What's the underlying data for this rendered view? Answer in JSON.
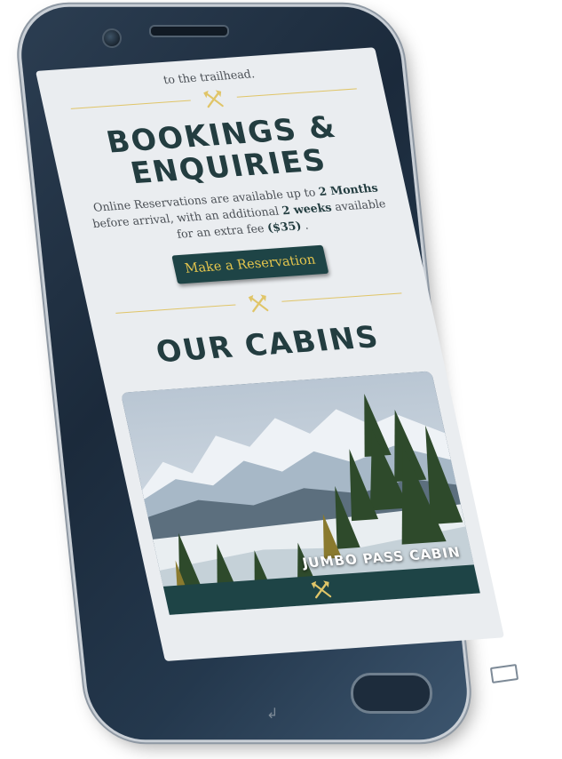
{
  "top": {
    "trailhead_text": "to the trailhead."
  },
  "bookings": {
    "heading": "Bookings & Enquiries",
    "text_part1": "Online Reservations are available up to ",
    "text_bold1": "2 Months",
    "text_part2": " before arrival, with an additional ",
    "text_bold2": "2 weeks",
    "text_part3": " available for an extra fee ",
    "text_bold3": "($35)",
    "text_part4": " .",
    "button_label": "Make a Reservation"
  },
  "cabins": {
    "heading": "Our Cabins",
    "card_title": "Jumbo Pass Cabin"
  },
  "colors": {
    "accent_gold": "#e0c568",
    "dark_teal": "#1e4446",
    "screen_bg": "#eaedf0"
  },
  "icons": {
    "divider": "crossed-axes-icon",
    "back": "back-arrow-icon",
    "recent": "recent-apps-icon"
  }
}
